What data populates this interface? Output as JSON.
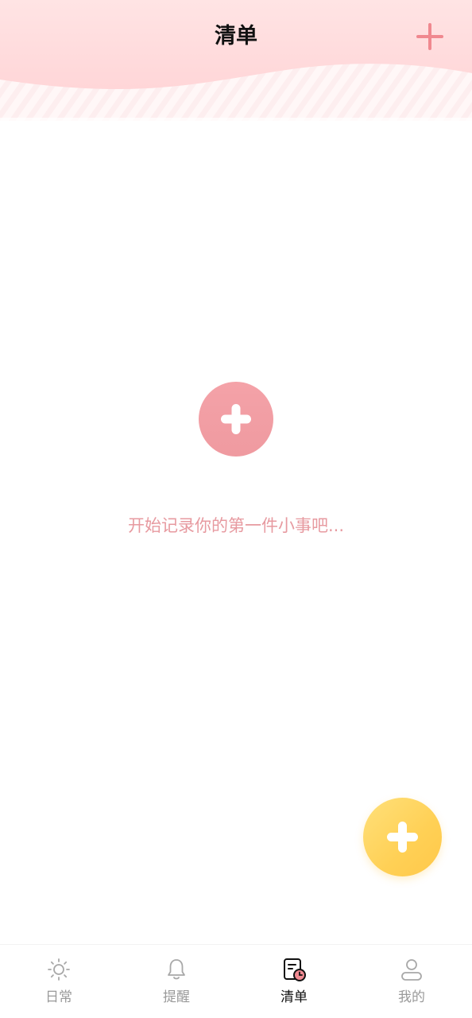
{
  "header": {
    "title": "清单",
    "add_icon": "plus-icon",
    "gradient_top": "#ffdfe0",
    "gradient_bottom": "#fff3f3",
    "accent": "#f0888f"
  },
  "empty_state": {
    "add_icon": "plus-icon",
    "hint": "开始记录你的第一件小事吧...",
    "button_color": "#f4a2a8",
    "text_color": "#e79aa0"
  },
  "fab": {
    "icon": "plus-icon",
    "color": "#ffd055"
  },
  "tabbar": {
    "items": [
      {
        "label": "日常",
        "icon": "sun-icon",
        "active": false
      },
      {
        "label": "提醒",
        "icon": "bell-icon",
        "active": false
      },
      {
        "label": "清单",
        "icon": "checklist-clock-icon",
        "active": true
      },
      {
        "label": "我的",
        "icon": "user-icon",
        "active": false
      }
    ],
    "inactive_color": "#9a9a9a",
    "active_color": "#111111",
    "active_badge_color": "#f08a92"
  }
}
